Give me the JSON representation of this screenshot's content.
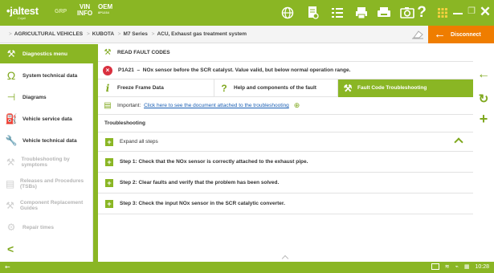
{
  "topbar": {
    "logo": "jaltest",
    "logo_sub": "Cojali",
    "grp": "GRP",
    "vin_top": "VIN",
    "vin_bottom": "INFO",
    "oem": "OEM",
    "oem_sub": "8P1234",
    "icons": [
      "globe-icon",
      "document-search-icon",
      "list-icon",
      "printer-icon",
      "print-icon",
      "camera-icon",
      "help-icon",
      "apps-icon"
    ]
  },
  "breadcrumb": {
    "items": [
      "AGRICULTURAL VEHICLES",
      "KUBOTA",
      "M7 Series",
      "ACU, Exhaust gas treatment system"
    ],
    "disconnect_label": "Disconnect"
  },
  "sidebar": {
    "items": [
      {
        "label": "Diagnostics menu",
        "icon": "diagnostics-icon",
        "active": true,
        "disabled": false
      },
      {
        "label": "System technical data",
        "icon": "omega-icon",
        "active": false,
        "disabled": false
      },
      {
        "label": "Diagrams",
        "icon": "diagram-icon",
        "active": false,
        "disabled": false
      },
      {
        "label": "Vehicle service data",
        "icon": "oil-can-icon",
        "active": false,
        "disabled": false
      },
      {
        "label": "Vehicle technical data",
        "icon": "wrench-icon",
        "active": false,
        "disabled": false
      },
      {
        "label": "Troubleshooting by symptoms",
        "icon": "tools-icon",
        "active": false,
        "disabled": true
      },
      {
        "label": "Releases and Procedures (TSBs)",
        "icon": "document-icon",
        "active": false,
        "disabled": true
      },
      {
        "label": "Component Replacement Guides",
        "icon": "tools-icon",
        "active": false,
        "disabled": true
      },
      {
        "label": "Repair times",
        "icon": "gear-icon",
        "active": false,
        "disabled": true
      }
    ]
  },
  "main": {
    "section_title": "READ FAULT CODES",
    "fault": {
      "code": "P1A21",
      "separator": "–",
      "description": "NOx sensor before the SCR catalyst. Value valid, but below normal operation range."
    },
    "tabs": [
      {
        "label": "Freeze Frame Data",
        "icon": "info-icon",
        "active": false
      },
      {
        "label": "Help and components of the fault",
        "icon": "question-icon",
        "active": false
      },
      {
        "label": "Fault Code Troubleshooting",
        "icon": "tools-icon",
        "active": true
      }
    ],
    "important_label": "Important:",
    "important_link": "Click here to see the document attached to the troubleshooting",
    "troubleshooting_title": "Troubleshooting",
    "expand_all": "Expand all steps",
    "steps": [
      "Step 1: Check that the NOx sensor is correctly attached to the exhaust pipe.",
      "Step 2: Clear faults and verify that the problem has been solved.",
      "Step 3: Check the input NOx sensor in the SCR catalytic converter."
    ]
  },
  "statusbar": {
    "time": "10:28"
  }
}
